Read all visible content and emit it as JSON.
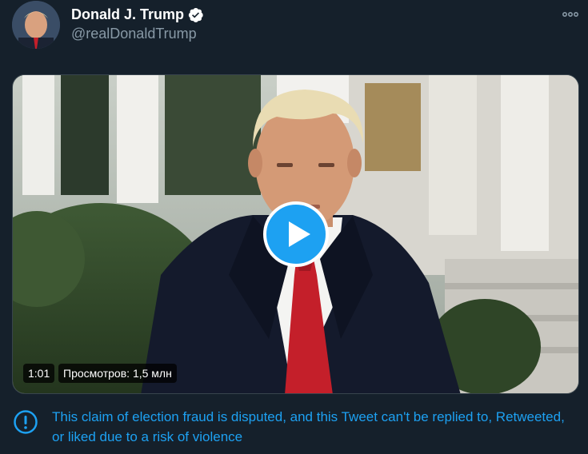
{
  "user": {
    "display_name": "Donald J. Trump",
    "handle": "@realDonaldTrump",
    "verified": true
  },
  "icons": {
    "verified": "verified-badge-icon",
    "more": "more-options-icon",
    "play": "play-icon",
    "notice": "exclamation-circle-icon"
  },
  "video": {
    "duration": "1:01",
    "views": "Просмотров: 1,5 млн"
  },
  "notice": {
    "text": "This claim of election fraud is disputed, and this Tweet can't be replied to, Retweeted, or liked due to a risk of violence"
  },
  "colors": {
    "background": "#15202b",
    "accent": "#1da1f2",
    "secondary_text": "#8899a6"
  }
}
